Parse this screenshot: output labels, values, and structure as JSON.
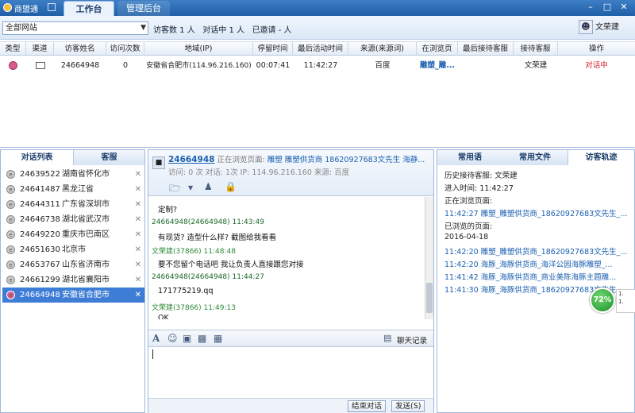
{
  "app": {
    "title": "商盟通",
    "tabs": [
      "工作台",
      "管理后台"
    ]
  },
  "toolbar": {
    "site_filter": "全部网站",
    "visitor_count_label": "访客数 1 人",
    "dialog_count_label": "对话中 1 人",
    "invited_label": "已邀请 - 人",
    "user_name": "文荣建"
  },
  "visitor_table": {
    "columns": [
      "类型",
      "渠道",
      "访客姓名",
      "访问次数",
      "地域(IP)",
      "停留时间",
      "最后活动时间",
      "来源(来源词)",
      "在浏览页",
      "最后接待客服",
      "接待客服",
      "操作"
    ],
    "rows": [
      {
        "name": "24664948",
        "visits": "0",
        "region": "安徽省合肥市(114.96.216.160)",
        "stay": "00:07:41",
        "last_active": "11:42:27",
        "source": "百度",
        "page": "雕塑_雕...",
        "last_agent": "",
        "agent": "文荣建",
        "status": "对话中"
      }
    ]
  },
  "left_panel": {
    "tabs": [
      "对话列表",
      "客服"
    ],
    "items": [
      {
        "id": "24639522",
        "loc": "湖南省怀化市"
      },
      {
        "id": "24641487",
        "loc": "黑龙江省"
      },
      {
        "id": "24644311",
        "loc": "广东省深圳市"
      },
      {
        "id": "24646738",
        "loc": "湖北省武汉市"
      },
      {
        "id": "24649220",
        "loc": "重庆市巴南区"
      },
      {
        "id": "24651630",
        "loc": "北京市"
      },
      {
        "id": "24653767",
        "loc": "山东省济南市"
      },
      {
        "id": "24661299",
        "loc": "湖北省襄阳市"
      },
      {
        "id": "24664948",
        "loc": "安徽省合肥市"
      }
    ]
  },
  "chat": {
    "visitor_id": "24664948",
    "browsing_label": "正在浏览页面:",
    "browsing_page": "雕塑 雕塑供货商 18620927683文先生 海静...",
    "info_line": "访问: 0 次 对话: 1次 IP: 114.96.216.160 来源: 百度",
    "messages": [
      {
        "kind": "body",
        "text": "定制?"
      },
      {
        "kind": "hd-v",
        "text": "24664948(24664948)  11:43:49"
      },
      {
        "kind": "body",
        "text": "有现货? 造型什么样? 截图给我看看"
      },
      {
        "kind": "hd-a",
        "text": "文荣建(37866)  11:48:48"
      },
      {
        "kind": "body",
        "text": "要不您留个电话吧  我让负责人直接跟您对接"
      },
      {
        "kind": "hd-v",
        "text": "24664948(24664948)  11:44:27"
      },
      {
        "kind": "body",
        "text": "171775219.qq"
      },
      {
        "kind": "hd-a",
        "text": "文荣建(37866)  11:49:13"
      },
      {
        "kind": "body",
        "text": "OK"
      }
    ],
    "history_label": "聊天记录",
    "end_button": "结束对话",
    "send_button": "发送(S)"
  },
  "right_panel": {
    "tabs": [
      "常用语",
      "常用文件",
      "访客轨迹"
    ],
    "track": [
      {
        "text": "历史接待客服: 文荣建",
        "link": false
      },
      {
        "text": "进入时间: 11:42:27",
        "link": false
      },
      {
        "text": "正在浏览页面:",
        "link": false
      },
      {
        "text": "11:42:27 雕塑_雕塑供货商_18620927683文先生_...",
        "link": true
      },
      {
        "text": "已浏览的页面:",
        "link": false
      },
      {
        "text": "2016-04-18",
        "link": false
      },
      {
        "text": "11:42:20 雕塑_雕塑供货商_18620927683文先生_...",
        "link": true
      },
      {
        "text": "11:42:20 海豚_海豚供货商_海洋公园海豚雕塑_...",
        "link": true
      },
      {
        "text": "11:41:42 海豚_海豚供货商_商业美陈海豚主题雕...",
        "link": true
      },
      {
        "text": "11:41:30 海豚_海豚供货商_18620927683文先生_...",
        "link": true
      }
    ],
    "badge": "72%",
    "badge_side": [
      "1.",
      "1."
    ]
  }
}
